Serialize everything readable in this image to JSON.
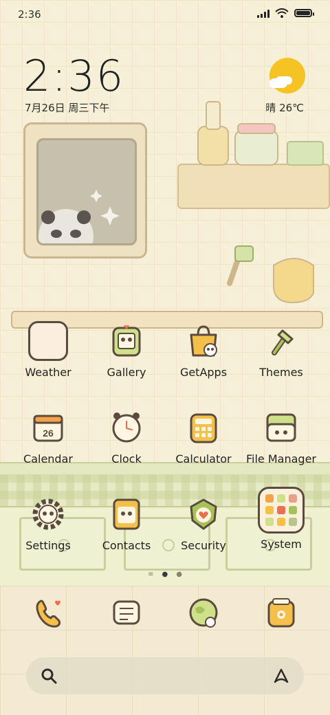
{
  "status_bar": {
    "time": "2:36",
    "icons": [
      "signal-icon",
      "wifi-icon",
      "battery-icon"
    ]
  },
  "clock_widget": {
    "time": "2:36",
    "date": "7月26日 周三下午"
  },
  "weather_widget": {
    "text": "晴 26℃",
    "icon": "sunny-cloud-icon"
  },
  "apps": [
    {
      "id": "weather",
      "label": "Weather",
      "icon": "weather-icon"
    },
    {
      "id": "gallery",
      "label": "Gallery",
      "icon": "gallery-icon"
    },
    {
      "id": "getapps",
      "label": "GetApps",
      "icon": "shopping-bag-icon"
    },
    {
      "id": "themes",
      "label": "Themes",
      "icon": "paintbrush-icon"
    },
    {
      "id": "calendar",
      "label": "Calendar",
      "icon": "calendar-icon",
      "badge": "26"
    },
    {
      "id": "clock",
      "label": "Clock",
      "icon": "clock-icon"
    },
    {
      "id": "calculator",
      "label": "Calculator",
      "icon": "calculator-icon"
    },
    {
      "id": "file-manager",
      "label": "File Manager",
      "icon": "folder-icon"
    },
    {
      "id": "settings",
      "label": "Settings",
      "icon": "gear-icon"
    },
    {
      "id": "contacts",
      "label": "Contacts",
      "icon": "contacts-icon"
    },
    {
      "id": "security",
      "label": "Security",
      "icon": "shield-icon"
    },
    {
      "id": "system",
      "label": "System",
      "icon": "folder-grid-icon"
    }
  ],
  "page_indicator": {
    "pages": 3,
    "current": 1
  },
  "dock": [
    {
      "id": "phone",
      "icon": "phone-icon"
    },
    {
      "id": "messages",
      "icon": "message-icon"
    },
    {
      "id": "browser",
      "icon": "globe-icon"
    },
    {
      "id": "app-store",
      "icon": "store-icon"
    }
  ],
  "search_bar": {
    "left_icon": "search-icon",
    "right_icon": "assistant-icon"
  },
  "colors": {
    "sun": "#f6c325",
    "icon_outline": "#5b4a3e",
    "wallpaper": "#f7f0d8",
    "accent_green": "#a8c25a"
  }
}
